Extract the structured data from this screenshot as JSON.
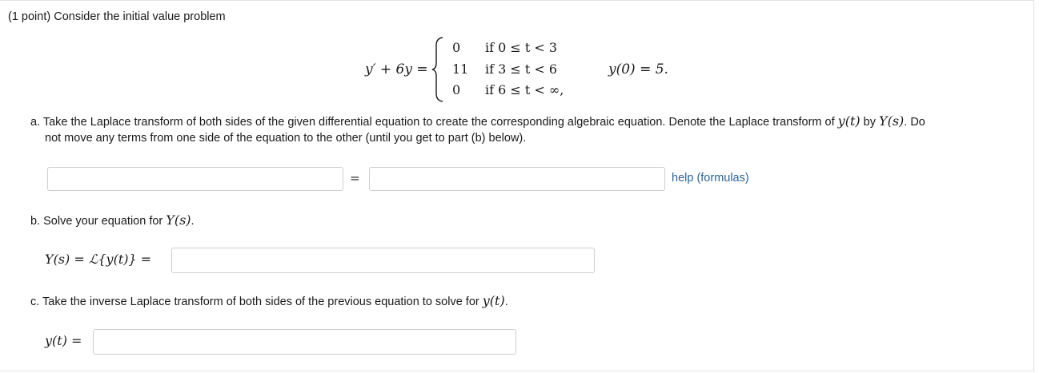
{
  "intro": {
    "points": "(1 point)",
    "text": "Consider the initial value problem"
  },
  "equation": {
    "lhs": "y′ + 6y =",
    "cases": [
      {
        "value": "0",
        "condition": "if 0 ≤ t < 3"
      },
      {
        "value": "11",
        "condition": "if 3 ≤ t < 6"
      },
      {
        "value": "0",
        "condition": "if 6 ≤ t < ∞,"
      }
    ],
    "initial_condition": "y(0) = 5."
  },
  "part_a": {
    "prefix": "a. Take the Laplace transform of both sides of the given differential equation to create the corresponding algebraic equation. Denote the Laplace transform of",
    "yt": "y(t)",
    "by": "by",
    "Ys": "Y(s)",
    "suffix": ". Do",
    "line2": "not move any terms from one side of the equation to the other (until you get to part (b) below).",
    "equals": "=",
    "left_value": "",
    "right_value": "",
    "help_link": "help (formulas)"
  },
  "part_b": {
    "prefix": "b. Solve your equation for",
    "Ys": "Y(s)",
    "suffix": ".",
    "label": "Y(s) = ℒ{y(t)} =",
    "value": ""
  },
  "part_c": {
    "prefix": "c. Take the inverse Laplace transform of both sides of the previous equation to solve for",
    "yt": "y(t)",
    "suffix": ".",
    "label": "y(t) =",
    "value": ""
  }
}
